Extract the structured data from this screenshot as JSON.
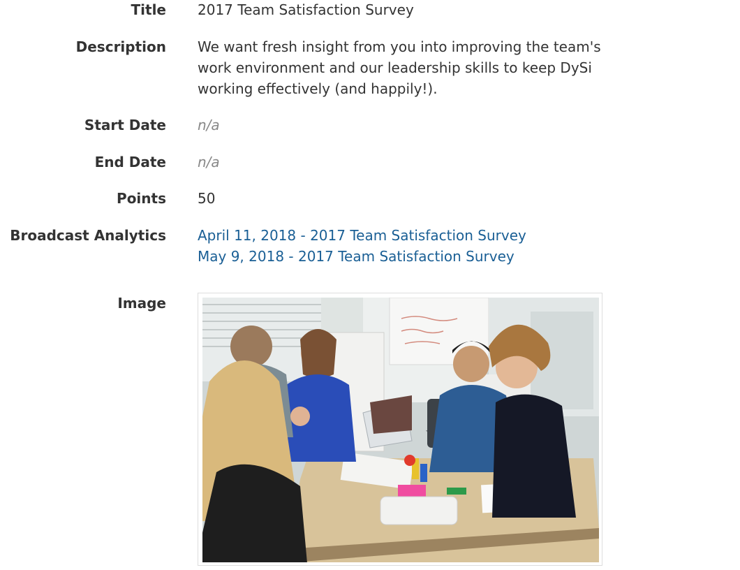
{
  "fields": {
    "title": {
      "label": "Title",
      "value": "2017 Team Satisfaction Survey"
    },
    "description": {
      "label": "Description",
      "value": "We want fresh insight from you into improving the team's work environment and our leadership skills to keep DySi working effectively (and happily!)."
    },
    "start_date": {
      "label": "Start Date",
      "value": "n/a"
    },
    "end_date": {
      "label": "End Date",
      "value": "n/a"
    },
    "points": {
      "label": "Points",
      "value": "50"
    },
    "broadcast_analytics": {
      "label": "Broadcast Analytics",
      "links": [
        "April 11, 2018 - 2017 Team Satisfaction Survey",
        "May 9, 2018 - 2017 Team Satisfaction Survey"
      ]
    },
    "image": {
      "label": "Image"
    }
  },
  "colors": {
    "label": "#333333",
    "value": "#333333",
    "muted": "#888888",
    "link": "#1a5f95"
  }
}
